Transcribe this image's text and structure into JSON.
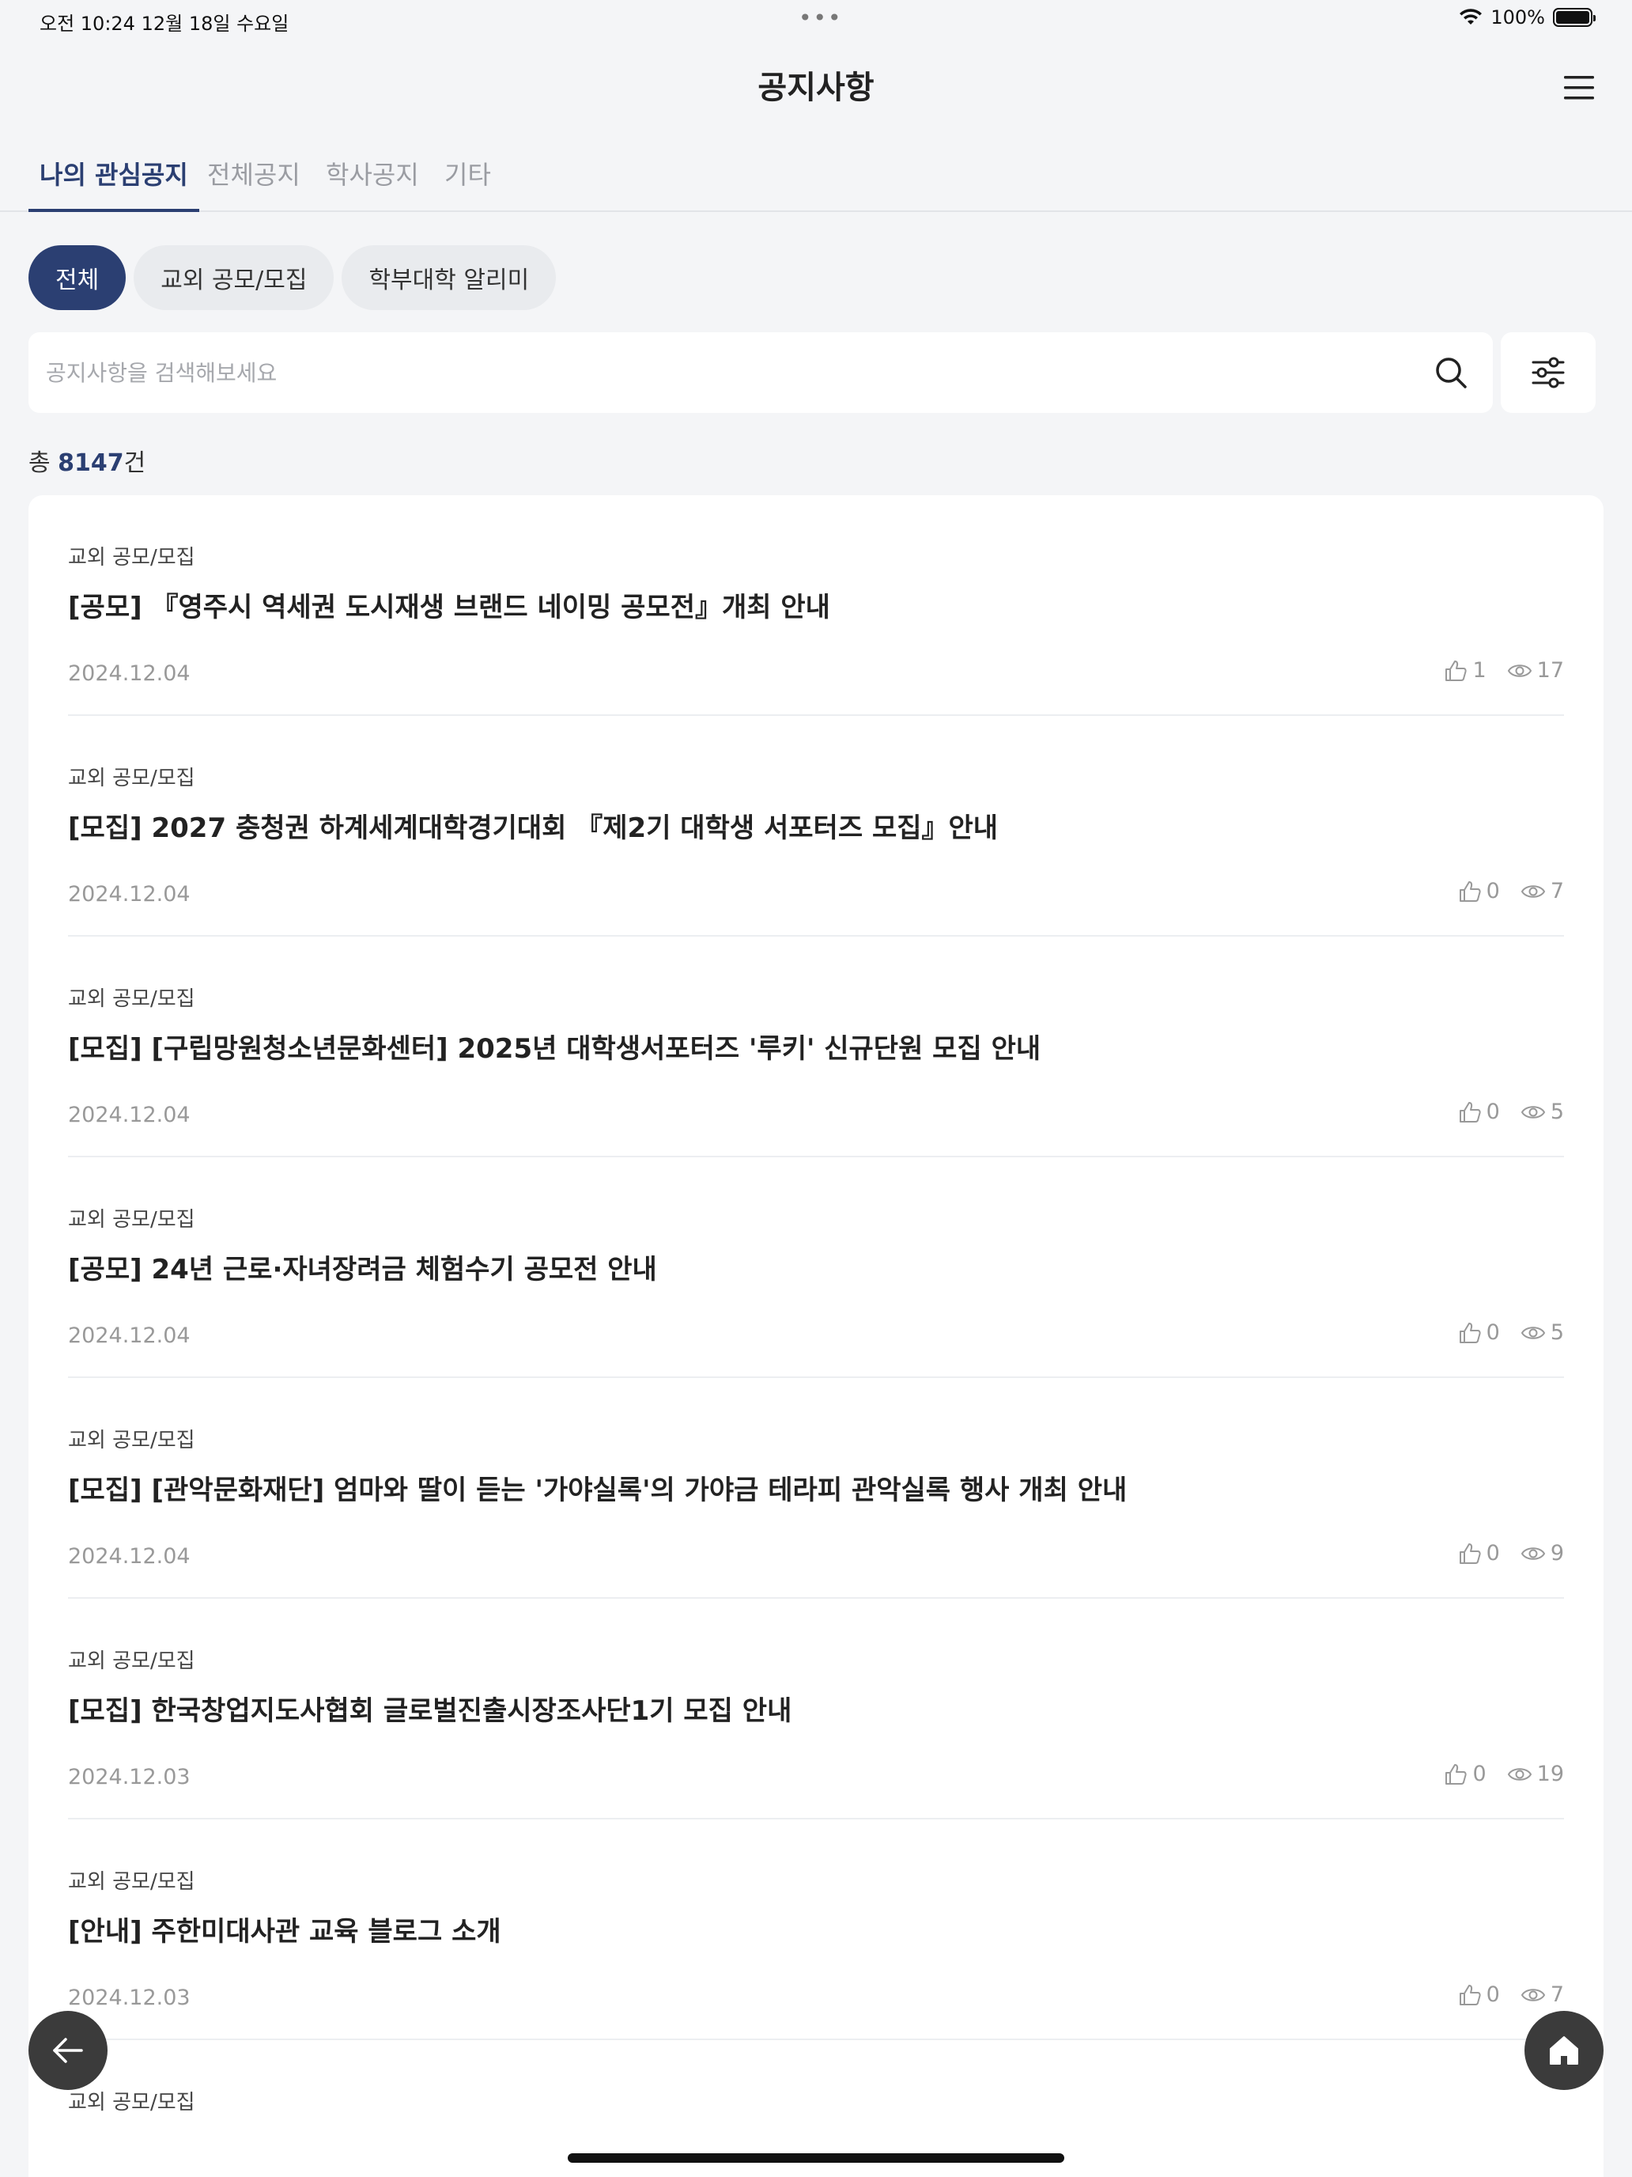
{
  "status_bar": {
    "time": "오전 10:24   12월 18일 수요일",
    "battery": "100%"
  },
  "header": {
    "title": "공지사항"
  },
  "tabs": [
    {
      "label": "나의 관심공지",
      "active": true
    },
    {
      "label": "전체공지",
      "active": false
    },
    {
      "label": "학사공지",
      "active": false
    },
    {
      "label": "기타",
      "active": false
    }
  ],
  "chips": [
    {
      "label": "전체",
      "active": true
    },
    {
      "label": "교외 공모/모집",
      "active": false
    },
    {
      "label": "학부대학 알리미",
      "active": false
    }
  ],
  "search": {
    "placeholder": "공지사항을 검색해보세요"
  },
  "total": {
    "prefix": "총 ",
    "count": "8147",
    "suffix": "건"
  },
  "notices": [
    {
      "category": "교외 공모/모집",
      "title": "[공모] 『영주시 역세권 도시재생 브랜드 네이밍 공모전』개최 안내",
      "date": "2024.12.04",
      "likes": "1",
      "views": "17"
    },
    {
      "category": "교외 공모/모집",
      "title": "[모집] 2027 충청권 하계세계대학경기대회 『제2기 대학생 서포터즈 모집』안내",
      "date": "2024.12.04",
      "likes": "0",
      "views": "7"
    },
    {
      "category": "교외 공모/모집",
      "title": "[모집] [구립망원청소년문화센터] 2025년 대학생서포터즈 '루키' 신규단원 모집 안내",
      "date": "2024.12.04",
      "likes": "0",
      "views": "5"
    },
    {
      "category": "교외 공모/모집",
      "title": "[공모] 24년 근로·자녀장려금 체험수기 공모전 안내",
      "date": "2024.12.04",
      "likes": "0",
      "views": "5"
    },
    {
      "category": "교외 공모/모집",
      "title": "[모집] [관악문화재단] 엄마와 딸이 듣는 '가야실록'의 가야금 테라피 관악실록 행사 개최 안내",
      "date": "2024.12.04",
      "likes": "0",
      "views": "9"
    },
    {
      "category": "교외 공모/모집",
      "title": "[모집] 한국창업지도사협회 글로벌진출시장조사단1기 모집 안내",
      "date": "2024.12.03",
      "likes": "0",
      "views": "19"
    },
    {
      "category": "교외 공모/모집",
      "title": "[안내] 주한미대사관 교육 블로그 소개",
      "date": "2024.12.03",
      "likes": "0",
      "views": "7"
    },
    {
      "category": "교외 공모/모집",
      "title": "",
      "date": "",
      "likes": "",
      "views": ""
    }
  ],
  "colors": {
    "accent": "#2b3f72",
    "background": "#f4f5f7",
    "fab": "#3b3b3b"
  }
}
